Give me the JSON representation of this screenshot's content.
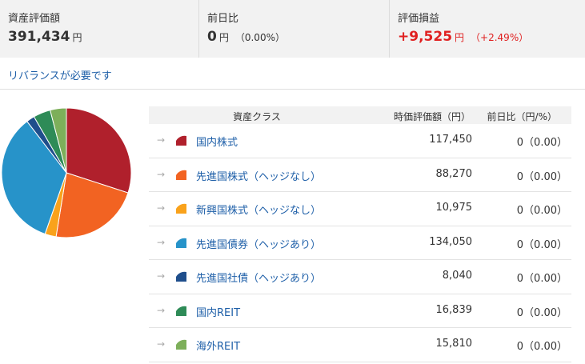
{
  "summary": {
    "total": {
      "label": "資産評価額",
      "value": "391,434",
      "unit": "円"
    },
    "daychange": {
      "label": "前日比",
      "value": "0",
      "unit": "円",
      "pct": "（0.00%）"
    },
    "gain": {
      "label": "評価損益",
      "value": "+9,525",
      "unit": "円",
      "pct": "（+2.49%）",
      "color": "#e02020"
    }
  },
  "rebalance_link": "リバランスが必要です",
  "table": {
    "headers": {
      "asset_class": "資産クラス",
      "value": "時価評価額（円）",
      "change": "前日比（円/%）"
    },
    "arrow_glyph": "→"
  },
  "chart_data": {
    "type": "pie",
    "categories": [
      "国内株式",
      "先進国株式（ヘッジなし）",
      "新興国株式（ヘッジなし）",
      "先進国債券（ヘッジあり）",
      "先進国社債（ヘッジあり）",
      "国内REIT",
      "海外REIT"
    ],
    "values": [
      117450,
      88270,
      10975,
      134050,
      8040,
      16839,
      15810
    ],
    "changes": [
      "0（0.00）",
      "0（0.00）",
      "0（0.00）",
      "0（0.00）",
      "0（0.00）",
      "0（0.00）",
      "0（0.00）"
    ],
    "display_values": [
      "117,450",
      "88,270",
      "10,975",
      "134,050",
      "8,040",
      "16,839",
      "15,810"
    ],
    "colors": [
      "#b0202c",
      "#f26322",
      "#f9a21b",
      "#2793c9",
      "#1f4e8c",
      "#2e8b57",
      "#7daf5a"
    ],
    "start_angle": "12 o'clock",
    "direction": "clockwise"
  }
}
